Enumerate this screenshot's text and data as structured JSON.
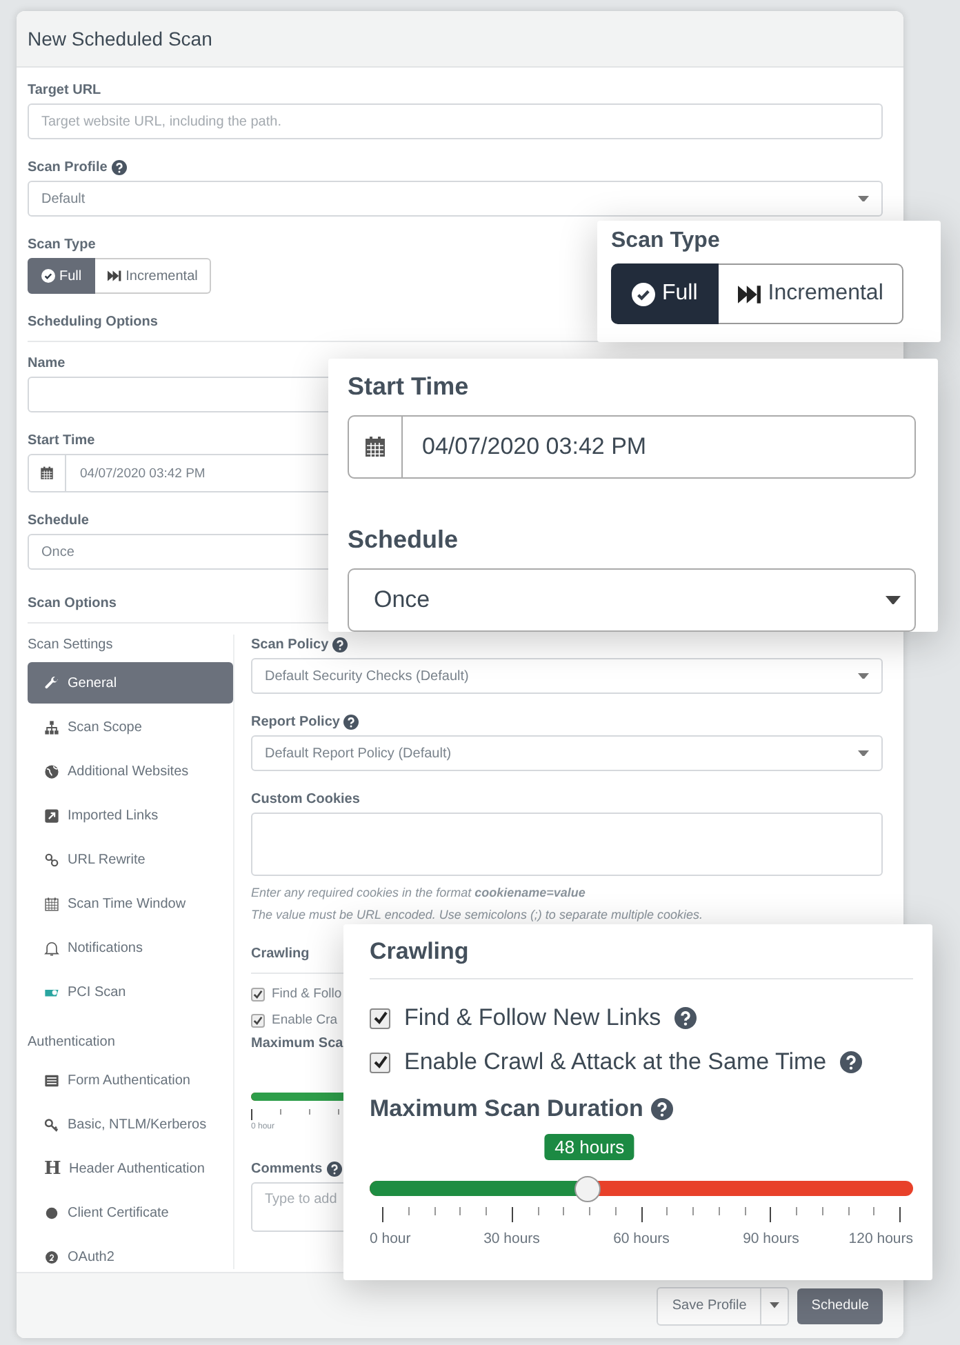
{
  "window": {
    "title": "New Scheduled Scan"
  },
  "form": {
    "target_url": {
      "label": "Target URL",
      "placeholder": "Target website URL, including the path."
    },
    "scan_profile": {
      "label": "Scan Profile",
      "value": "Default"
    },
    "scan_type": {
      "label": "Scan Type",
      "options": [
        {
          "label": "Full",
          "selected": true
        },
        {
          "label": "Incremental",
          "selected": false
        }
      ]
    },
    "scheduling_title": "Scheduling Options",
    "name": {
      "label": "Name"
    },
    "start_time": {
      "label": "Start Time",
      "value": "04/07/2020 03:42 PM"
    },
    "schedule": {
      "label": "Schedule",
      "value": "Once"
    },
    "scan_options_title": "Scan Options"
  },
  "sidebar": {
    "groups": [
      {
        "title": "Scan Settings",
        "items": [
          {
            "label": "General",
            "selected": true
          },
          {
            "label": "Scan Scope",
            "selected": false
          },
          {
            "label": "Additional Websites",
            "selected": false
          },
          {
            "label": "Imported Links",
            "selected": false
          },
          {
            "label": "URL Rewrite",
            "selected": false
          },
          {
            "label": "Scan Time Window",
            "selected": false
          },
          {
            "label": "Notifications",
            "selected": false
          },
          {
            "label": "PCI Scan",
            "selected": false
          }
        ]
      },
      {
        "title": "Authentication",
        "items": [
          {
            "label": "Form Authentication",
            "selected": false
          },
          {
            "label": "Basic, NTLM/Kerberos",
            "selected": false
          },
          {
            "label": "Header Authentication",
            "selected": false,
            "glyph": "H"
          },
          {
            "label": "Client Certificate",
            "selected": false
          },
          {
            "label": "OAuth2",
            "selected": false
          }
        ]
      }
    ]
  },
  "settings": {
    "scan_policy": {
      "label": "Scan Policy",
      "value": "Default Security Checks (Default)"
    },
    "report_policy": {
      "label": "Report Policy",
      "value": "Default Report Policy (Default)"
    },
    "custom_cookies": {
      "label": "Custom Cookies",
      "help": [
        "Enter any required cookies in the format **cookiename=value**",
        "The value must be URL encoded. Use semicolons (;) to separate multiple cookies."
      ]
    },
    "crawling": {
      "label": "Crawling",
      "options": [
        {
          "label": "Find & Follo",
          "checked": true
        },
        {
          "label": "Enable Cra",
          "checked": true
        }
      ]
    },
    "max_duration": {
      "label": "Maximum Sca",
      "level": 0.4,
      "tick_labels": [
        "0 hour"
      ]
    },
    "comments": {
      "label": "Comments",
      "placeholder": "Type to add"
    }
  },
  "footer": {
    "buttons": [
      {
        "label": "Save Profile",
        "kind": "split"
      },
      {
        "label": "Schedule",
        "kind": "primary"
      }
    ]
  },
  "callouts": [
    {
      "kind": "scan_type",
      "label": "Scan Type",
      "options": [
        {
          "label": "Full",
          "selected": true
        },
        {
          "label": "Incremental",
          "selected": false
        }
      ]
    },
    {
      "kind": "time",
      "start_label": "Start Time",
      "start_value": "04/07/2020 03:42 PM",
      "schedule_label": "Schedule",
      "schedule_value": "Once"
    },
    {
      "kind": "crawling",
      "label": "Crawling",
      "options": [
        {
          "label": "Find & Follow New Links",
          "checked": true
        },
        {
          "label": "Enable Crawl & Attack at the Same Time",
          "checked": true
        }
      ],
      "duration_label": "Maximum Scan Duration",
      "value": "48 hours",
      "level": 0.4,
      "tick_labels": [
        "0 hour",
        "30 hours",
        "60 hours",
        "90 hours",
        "120 hours"
      ]
    }
  ]
}
